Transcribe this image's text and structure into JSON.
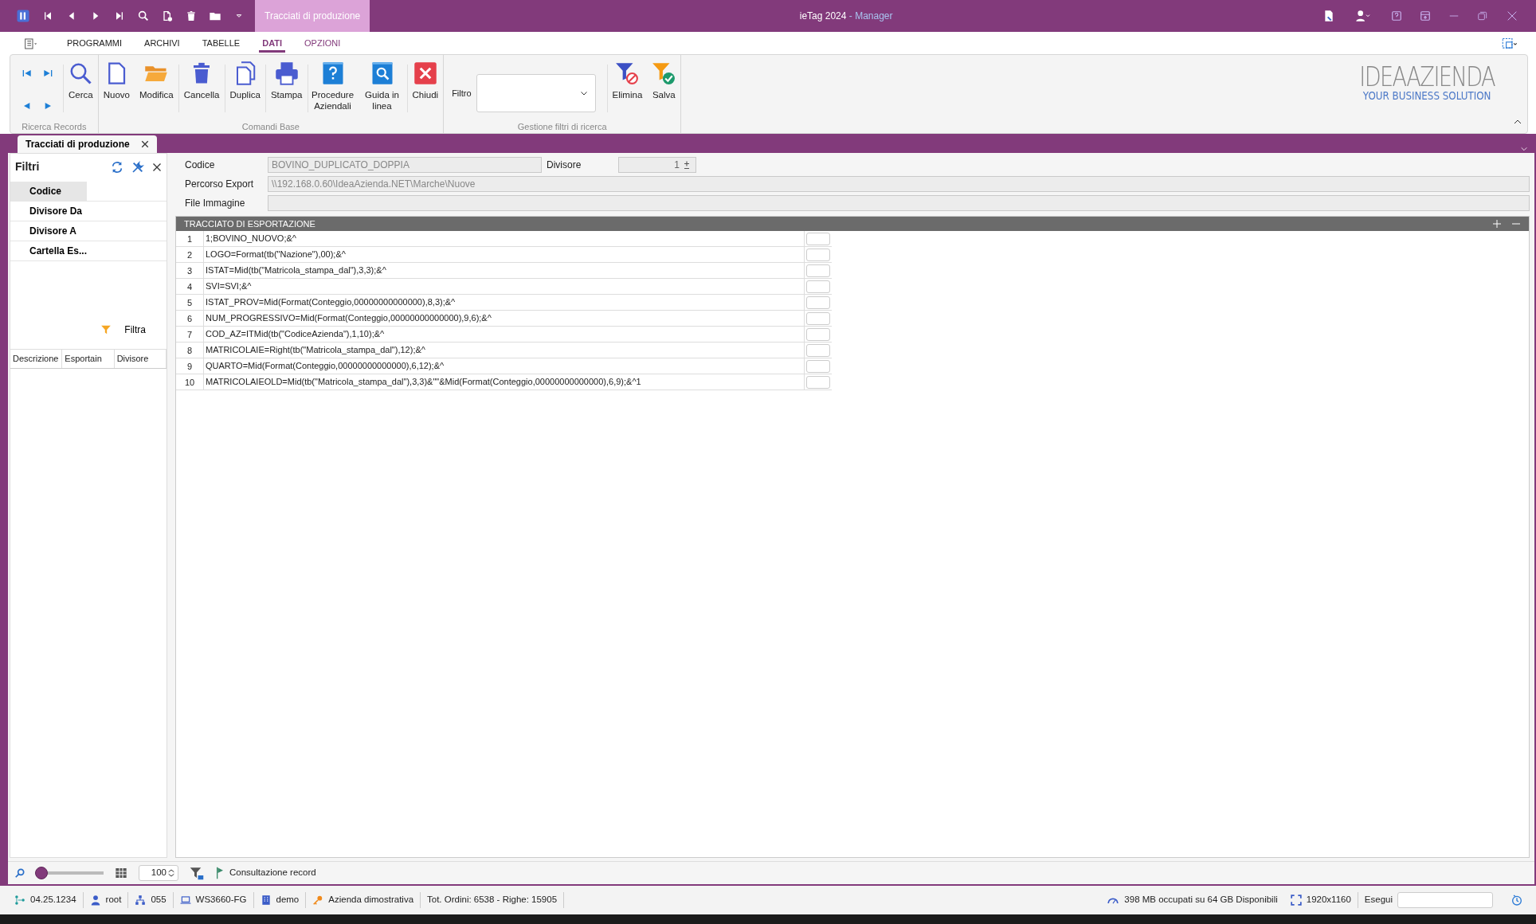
{
  "title_bar": {
    "doc_tab": "Tracciati di produzione",
    "app_title": "ieTag 2024",
    "app_subtitle": "- Manager"
  },
  "menu_tabs": [
    {
      "label": "PROGRAMMI",
      "selected": false,
      "kind": "normal"
    },
    {
      "label": "ARCHIVI",
      "selected": false,
      "kind": "normal"
    },
    {
      "label": "TABELLE",
      "selected": false,
      "kind": "normal"
    },
    {
      "label": "DATI",
      "selected": true,
      "kind": "normal"
    },
    {
      "label": "OPZIONI",
      "selected": false,
      "kind": "contextual"
    }
  ],
  "ribbon": {
    "groups": [
      {
        "label": "Ricerca Records",
        "items": [
          {
            "kind": "nav",
            "separated": false
          },
          {
            "kind": "button",
            "label": "Cerca",
            "separated": true
          }
        ]
      },
      {
        "label": "Comandi Base",
        "items": [
          {
            "kind": "button",
            "label": "Nuovo",
            "separated": false
          },
          {
            "kind": "button",
            "label": "Modifica",
            "separated": false
          },
          {
            "kind": "button",
            "label": "Cancella",
            "separated": true
          },
          {
            "kind": "button",
            "label": "Duplica",
            "separated": true
          },
          {
            "kind": "button",
            "label": "Stampa",
            "separated": true
          },
          {
            "kind": "button",
            "label": "Procedure Aziendali",
            "separated": true
          },
          {
            "kind": "button",
            "label": "Guida in linea",
            "separated": false
          },
          {
            "kind": "button",
            "label": "Chiudi",
            "separated": true
          }
        ]
      },
      {
        "label": "Gestione filtri di ricerca",
        "items": [
          {
            "kind": "combo",
            "label": "Filtro",
            "separated": false
          },
          {
            "kind": "button",
            "label": "Elimina",
            "separated": true
          },
          {
            "kind": "button",
            "label": "Salva",
            "separated": false
          }
        ]
      }
    ],
    "logo": {
      "name": "IDEAAZIENDA",
      "tagline": "YOUR BUSINESS SOLUTION"
    }
  },
  "doc_tabs": [
    {
      "label": "Tracciati di produzione",
      "selected": true
    }
  ],
  "filters_panel": {
    "title": "Filtri",
    "fields": [
      {
        "label": "Codice",
        "selected": true
      },
      {
        "label": "Divisore Da",
        "selected": false
      },
      {
        "label": "Divisore A",
        "selected": false
      },
      {
        "label": "Cartella Es...",
        "selected": false
      }
    ],
    "filter_button": "Filtra",
    "columns": [
      "Descrizione",
      "Esportain",
      "Divisore"
    ]
  },
  "form": {
    "codice": {
      "label": "Codice",
      "value": "BOVINO_DUPLICATO_DOPPIA"
    },
    "divisore": {
      "label": "Divisore",
      "value": "1"
    },
    "percorso": {
      "label": "Percorso Export",
      "value": "\\\\192.168.0.60\\IdeaAzienda.NET\\Marche\\Nuove"
    },
    "file_immagine": {
      "label": "File Immagine"
    }
  },
  "table": {
    "title": "TRACCIATO DI ESPORTAZIONE",
    "rows": [
      {
        "number": "1",
        "text": "1;BOVINO_NUOVO;&^"
      },
      {
        "number": "2",
        "text": "LOGO=Format(tb(\"Nazione\"),00);&^"
      },
      {
        "number": "3",
        "text": "ISTAT=Mid(tb(\"Matricola_stampa_dal\"),3,3);&^"
      },
      {
        "number": "4",
        "text": "SVI=SVI;&^"
      },
      {
        "number": "5",
        "text": "ISTAT_PROV=Mid(Format(Conteggio,00000000000000),8,3);&^"
      },
      {
        "number": "6",
        "text": "NUM_PROGRESSIVO=Mid(Format(Conteggio,00000000000000),9,6);&^"
      },
      {
        "number": "7",
        "text": "COD_AZ=ITMid(tb(\"CodiceAzienda\"),1,10);&^"
      },
      {
        "number": "8",
        "text": "MATRICOLAIE=Right(tb(\"Matricola_stampa_dal\"),12);&^"
      },
      {
        "number": "9",
        "text": "QUARTO=Mid(Format(Conteggio,00000000000000),6,12);&^"
      },
      {
        "number": "10",
        "text": "MATRICOLAIEOLD=Mid(tb(\"Matricola_stampa_dal\"),3,3)&\"\"&Mid(Format(Conteggio,00000000000000),6,9);&^1"
      }
    ]
  },
  "bottom_toolbar": {
    "zoom": {
      "level": 0
    },
    "page_size": "100",
    "status": "Consultazione record"
  },
  "status_bar": {
    "items": [
      {
        "text": "04.25.1234"
      },
      {
        "text": "root"
      },
      {
        "text": "055"
      },
      {
        "text": "WS3660-FG"
      },
      {
        "text": "demo"
      },
      {
        "text": "Azienda dimostrativa"
      },
      {
        "text": "Tot. Ordini: 6538 - Righe: 15905"
      }
    ],
    "memory": "398 MB occupati su 64 GB Disponibili",
    "resolution": "1920x1160",
    "run_label": "Esegui"
  }
}
